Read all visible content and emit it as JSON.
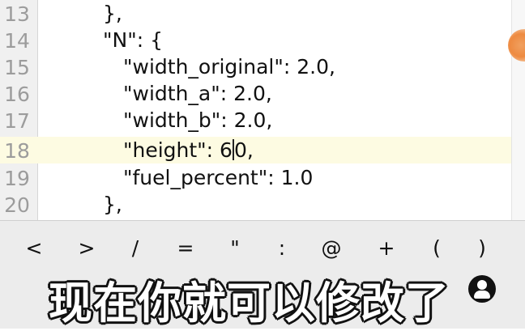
{
  "editor": {
    "lines": [
      {
        "number": "13",
        "text": "},"
      },
      {
        "number": "14",
        "text": "\"N\": {"
      },
      {
        "number": "15",
        "text": "\"width_original\": 2.0,"
      },
      {
        "number": "16",
        "text": "\"width_a\": 2.0,"
      },
      {
        "number": "17",
        "text": "\"width_b\": 2.0,"
      },
      {
        "number": "18",
        "text_before_cursor": "\"height\": 6",
        "text_after_cursor": "0,"
      },
      {
        "number": "19",
        "text": "\"fuel_percent\": 1.0"
      },
      {
        "number": "20",
        "text": "},"
      }
    ],
    "active_line": "18"
  },
  "keyboard": {
    "symbol_keys": [
      "<",
      ">",
      "/",
      "=",
      "\"",
      ":",
      "@",
      "+",
      "(",
      ")"
    ]
  },
  "subtitle": "现在你就可以修改了",
  "colors": {
    "active_line_bg": "#fdfbe2",
    "gutter_bg": "#f0f0f0",
    "line_number": "#9c9c9c",
    "floating_bubble": "#ee8a40"
  }
}
